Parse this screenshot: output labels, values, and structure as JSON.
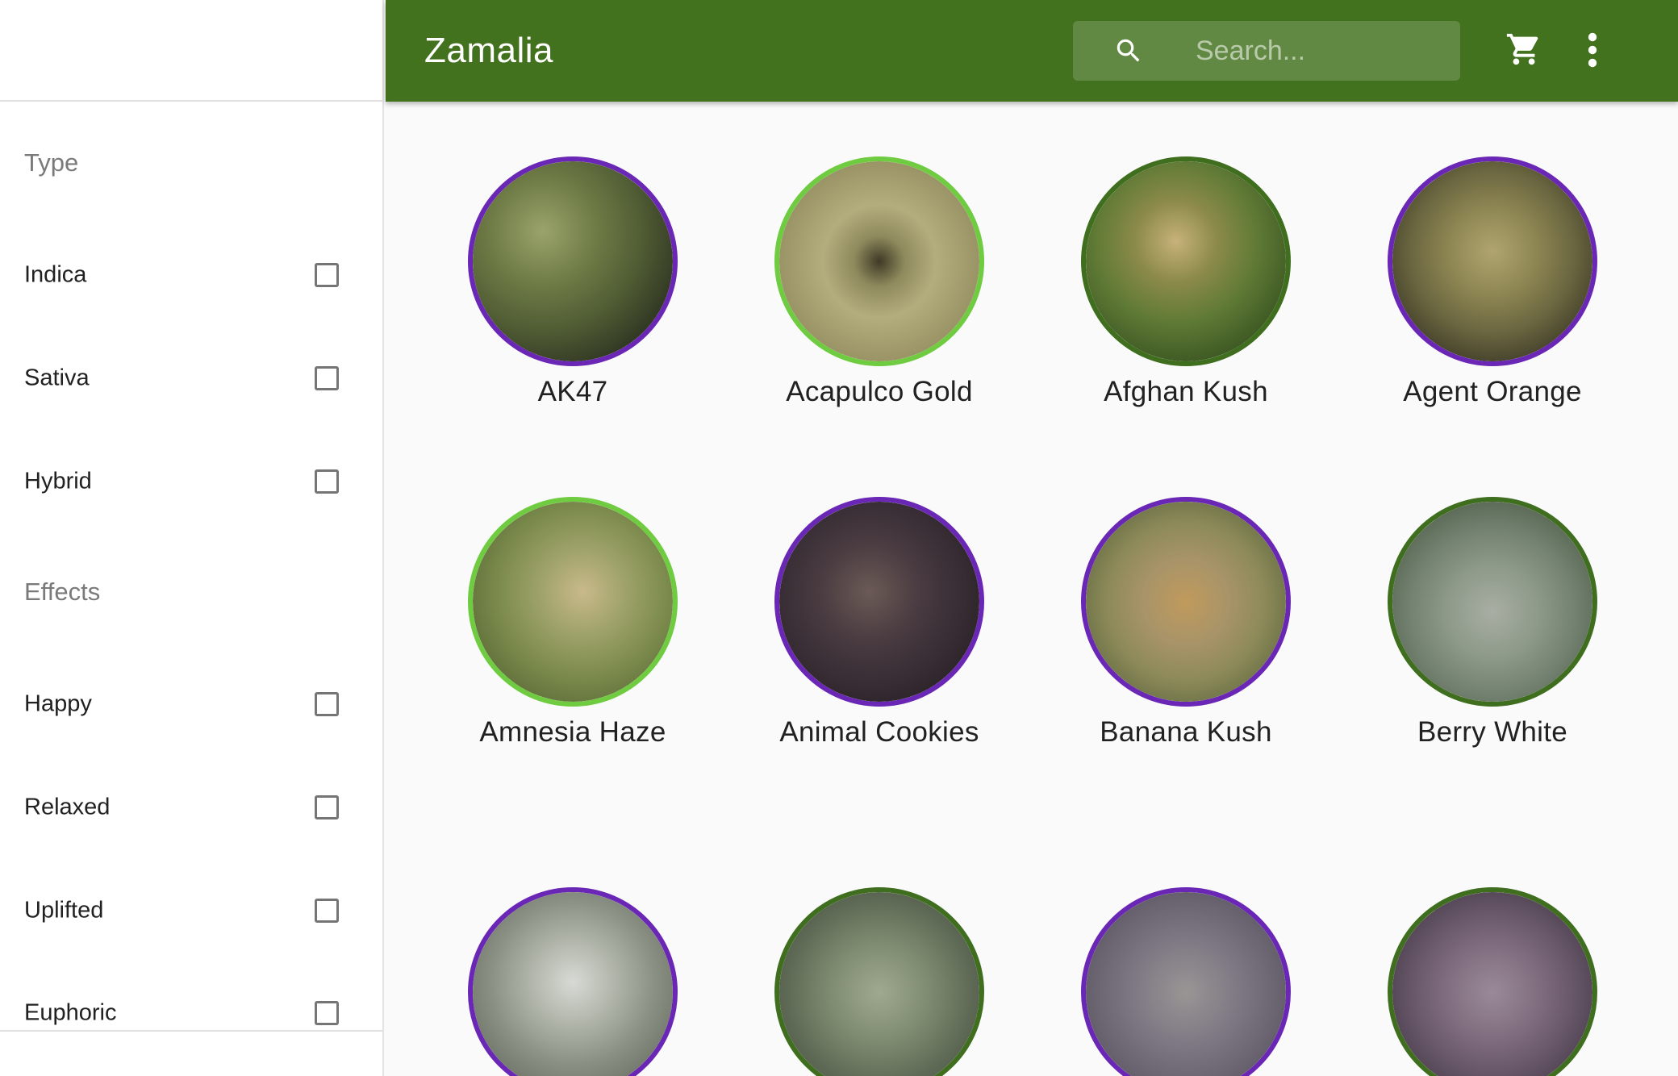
{
  "header": {
    "title": "Zamalia",
    "search_placeholder": "Search...",
    "brand_color": "#43721e",
    "icons": [
      "search-icon",
      "cart-icon",
      "more-vert-icon"
    ]
  },
  "sidebar": {
    "type_title": "Type",
    "type_items": [
      {
        "label": "Indica",
        "checked": false
      },
      {
        "label": "Sativa",
        "checked": false
      },
      {
        "label": "Hybrid",
        "checked": false
      }
    ],
    "effects_title": "Effects",
    "effects_items": [
      {
        "label": "Happy",
        "checked": false
      },
      {
        "label": "Relaxed",
        "checked": false
      },
      {
        "label": "Uplifted",
        "checked": false
      },
      {
        "label": "Euphoric",
        "checked": false
      }
    ]
  },
  "colors": {
    "purple_ring": "#6a26b5",
    "light_green_ring": "#6fcb3f",
    "dark_green_ring": "#3f6e1f"
  },
  "strains": [
    {
      "name": "AK47",
      "ring": "purple"
    },
    {
      "name": "Acapulco Gold",
      "ring": "light_green"
    },
    {
      "name": "Afghan Kush",
      "ring": "dark_green"
    },
    {
      "name": "Agent Orange",
      "ring": "purple"
    },
    {
      "name": "Amnesia Haze",
      "ring": "light_green"
    },
    {
      "name": "Animal Cookies",
      "ring": "purple"
    },
    {
      "name": "Banana Kush",
      "ring": "purple"
    },
    {
      "name": "Berry White",
      "ring": "dark_green"
    },
    {
      "name": "",
      "ring": "purple"
    },
    {
      "name": "",
      "ring": "dark_green"
    },
    {
      "name": "",
      "ring": "purple"
    },
    {
      "name": "",
      "ring": "dark_green"
    }
  ]
}
